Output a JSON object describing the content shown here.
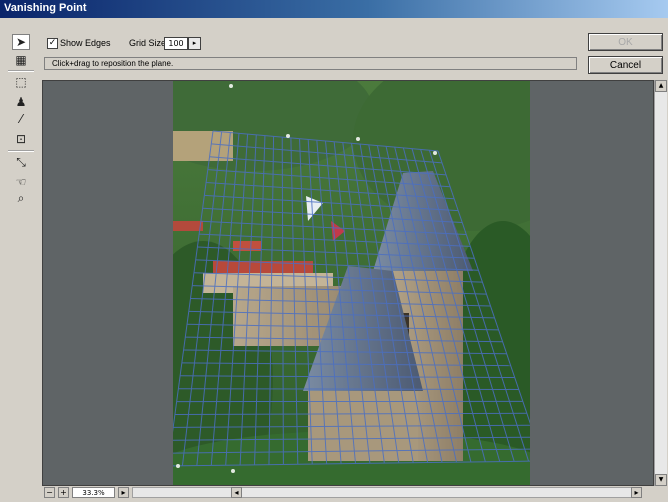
{
  "window": {
    "title": "Vanishing Point"
  },
  "options": {
    "show_edges_label": "Show Edges",
    "show_edges_checked": "✓",
    "grid_size_label": "Grid Size:",
    "grid_size_value": "100",
    "grid_size_arrow": "▸"
  },
  "hint": {
    "text": "Click+drag to reposition the plane."
  },
  "buttons": {
    "ok": "OK",
    "cancel": "Cancel"
  },
  "tools": [
    {
      "name": "edit-plane-tool",
      "icon": "arrow-pointer-icon",
      "glyph": "➤"
    },
    {
      "name": "create-plane-tool",
      "icon": "grid-plane-icon",
      "glyph": "▦"
    },
    {
      "name": "marquee-tool",
      "icon": "dashed-rectangle-icon",
      "glyph": "⬚"
    },
    {
      "name": "stamp-tool",
      "icon": "stamp-icon",
      "glyph": "♟"
    },
    {
      "name": "brush-tool",
      "icon": "brush-icon",
      "glyph": "⁄"
    },
    {
      "name": "transform-tool",
      "icon": "transform-icon",
      "glyph": "⊡"
    },
    {
      "name": "eyedropper-tool",
      "icon": "eyedropper-icon",
      "glyph": "⤡"
    },
    {
      "name": "hand-tool",
      "icon": "hand-icon",
      "glyph": "☜"
    },
    {
      "name": "zoom-tool",
      "icon": "magnifier-icon",
      "glyph": "⌕"
    }
  ],
  "status": {
    "zoom_value": "33.3%",
    "zoom_out": "−",
    "zoom_in": "+",
    "zoom_menu": "▸",
    "scroll_left": "◂",
    "scroll_right": "▸"
  },
  "scrollbar": {
    "up": "▲",
    "down": "▼"
  },
  "colors": {
    "titlebar_start": "#0a246a",
    "titlebar_end": "#a6caf0",
    "grid_line": "#4b6fc2",
    "canvas_bg": "#5f6466"
  }
}
